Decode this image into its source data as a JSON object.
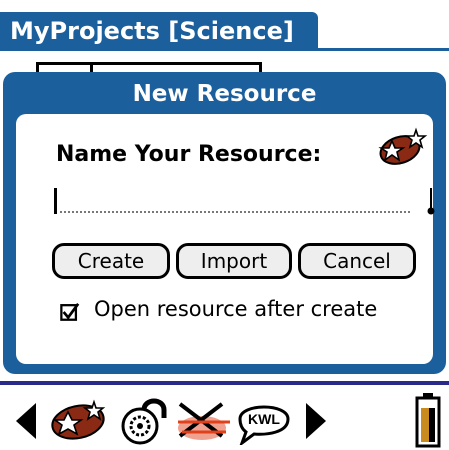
{
  "app": {
    "title": "MyProjects [Science]"
  },
  "dialog": {
    "title": "New Resource",
    "prompt": "Name Your Resource:",
    "name_field": {
      "value": "",
      "placeholder": ""
    },
    "buttons": {
      "create": "Create",
      "import": "Import",
      "cancel": "Cancel"
    },
    "open_after_create": {
      "label": "Open resource after create",
      "checked": true
    }
  },
  "toolbar": {
    "icons": [
      "left-arrow-icon",
      "star-football-icon",
      "lock-gear-icon",
      "crossed-tools-icon",
      "kwl-bubble-icon",
      "right-arrow-icon",
      "battery-icon"
    ],
    "kwl_text": "KWL"
  },
  "colors": {
    "accent": "#1b5f9c",
    "rule": "#2a2a8a"
  }
}
